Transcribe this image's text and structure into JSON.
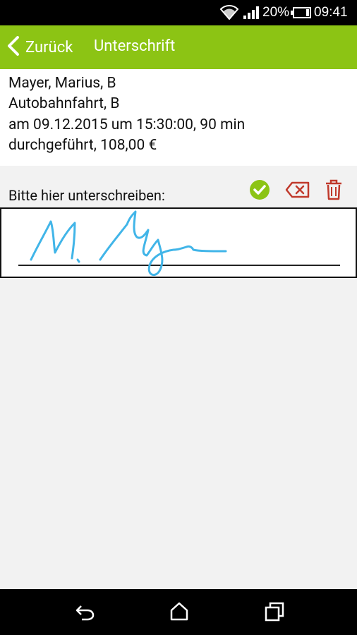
{
  "status": {
    "battery": "20%",
    "time": "09:41"
  },
  "appbar": {
    "back_label": "Zurück",
    "title": "Unterschrift"
  },
  "details": {
    "name": "Mayer, Marius, B",
    "lesson": "Autobahnfahrt, B",
    "datetime": "am 09.12.2015 um 15:30:00, 90 min",
    "result": "durchgeführt, 108,00 €"
  },
  "signature": {
    "prompt": "Bitte hier unterschreiben:"
  },
  "colors": {
    "accent": "#8cc414",
    "danger": "#c0392b",
    "ink": "#41b5e8"
  },
  "icons": [
    "wifi-icon",
    "signal-icon",
    "battery-icon",
    "back-chevron-icon",
    "check-circle-icon",
    "clear-icon",
    "trash-icon",
    "nav-back-icon",
    "nav-home-icon",
    "nav-recent-icon"
  ]
}
